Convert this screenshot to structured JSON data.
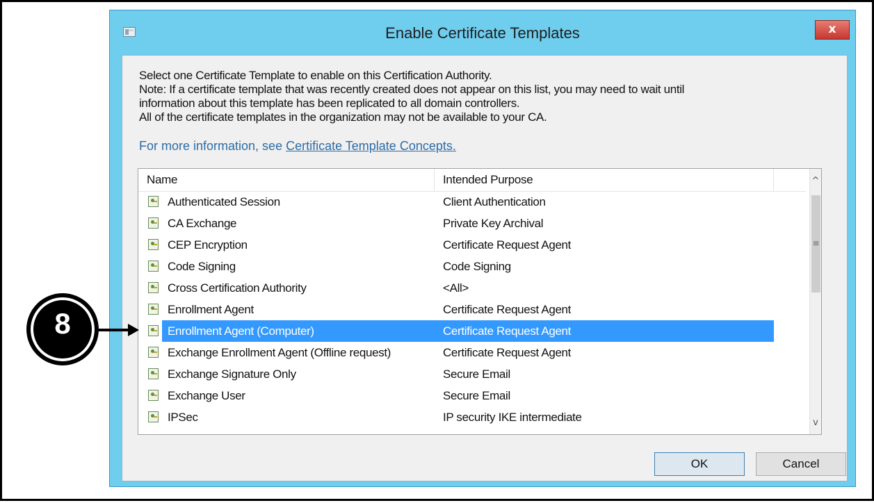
{
  "window": {
    "title": "Enable Certificate Templates",
    "close_label": "x"
  },
  "description": {
    "line1": "Select one Certificate Template to enable on this Certification Authority.",
    "line2": "Note: If a certificate template that was recently created does not appear on this list, you may need to wait until",
    "line3": "information about this template has been replicated to all domain controllers.",
    "line4": "All of the certificate templates in the organization may not be available to your CA.",
    "more_info_prefix": "For more information, see ",
    "more_info_link": "Certificate Template Concepts."
  },
  "list": {
    "columns": [
      "Name",
      "Intended Purpose"
    ],
    "rows": [
      {
        "name": "Authenticated Session",
        "purpose": "Client Authentication"
      },
      {
        "name": "CA Exchange",
        "purpose": "Private Key Archival"
      },
      {
        "name": "CEP Encryption",
        "purpose": "Certificate Request Agent"
      },
      {
        "name": "Code Signing",
        "purpose": "Code Signing"
      },
      {
        "name": "Cross Certification Authority",
        "purpose": "<All>"
      },
      {
        "name": "Enrollment Agent",
        "purpose": "Certificate Request Agent"
      },
      {
        "name": "Enrollment Agent (Computer)",
        "purpose": "Certificate Request Agent",
        "selected": true
      },
      {
        "name": "Exchange Enrollment Agent (Offline request)",
        "purpose": "Certificate Request Agent"
      },
      {
        "name": "Exchange Signature Only",
        "purpose": "Secure Email"
      },
      {
        "name": "Exchange User",
        "purpose": "Secure Email"
      },
      {
        "name": "IPSec",
        "purpose": "IP security IKE intermediate"
      }
    ],
    "scroll_up": "^",
    "scroll_down": "v",
    "scroll_grip": "≡"
  },
  "buttons": {
    "ok": "OK",
    "cancel": "Cancel"
  },
  "callout": {
    "number": "8"
  },
  "colors": {
    "window_frame": "#6fcdee",
    "selection": "#3399ff",
    "link": "#2d6ca6",
    "close_button": "#c7372e"
  }
}
